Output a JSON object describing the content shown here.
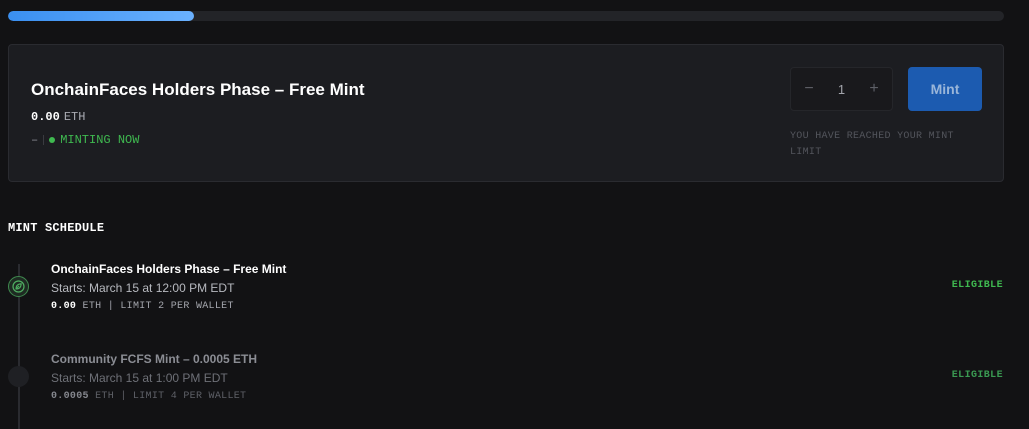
{
  "progress": {
    "fraction": 0.187,
    "color": "#4a9bf5"
  },
  "current_phase": {
    "title": "OnchainFaces Holders Phase – Free Mint",
    "price_amount": "0.00",
    "price_unit": "ETH",
    "dash": "–",
    "status": "MINTING NOW",
    "quantity": "1",
    "decrement_symbol": "−",
    "increment_symbol": "+",
    "mint_label": "Mint",
    "limit_note": "YOU HAVE REACHED YOUR MINT LIMIT"
  },
  "schedule": {
    "heading": "MINT SCHEDULE",
    "items": [
      {
        "title": "OnchainFaces Holders Phase – Free Mint",
        "start": "Starts: March 15 at 12:00 PM EDT",
        "price_amount": "0.00",
        "meta": "ETH | LIMIT 2 PER WALLET",
        "status": "ELIGIBLE",
        "icon": "leaf-icon"
      },
      {
        "title": "Community FCFS Mint – 0.0005 ETH",
        "start": "Starts: March 15 at 1:00 PM EDT",
        "price_amount": "0.0005",
        "meta": "ETH | LIMIT 4 PER WALLET",
        "status": "ELIGIBLE"
      }
    ]
  },
  "colors": {
    "accent_green": "#3fb950",
    "mint_button": "#1c5bb0",
    "background": "#121214",
    "card": "#1c1d21"
  }
}
